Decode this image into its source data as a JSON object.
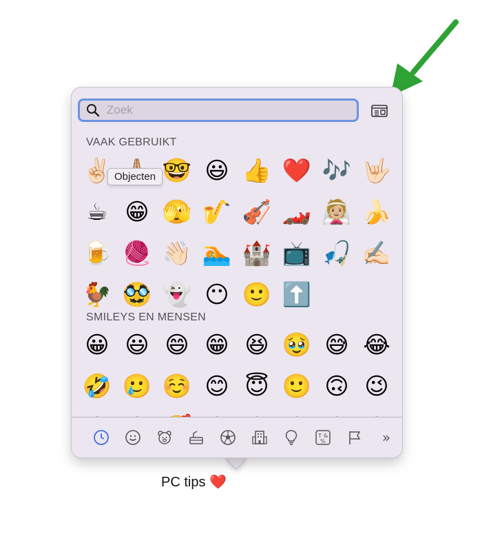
{
  "search": {
    "placeholder": "Zoek"
  },
  "tooltip": "Objecten",
  "sections": [
    {
      "title": "VAAK GEBRUIKT",
      "emojis": [
        "✌🏻",
        "🙏🏼",
        "🤓",
        "😃",
        "👍",
        "❤️",
        "🎶",
        "🤟🏻",
        "☕",
        "😁",
        "🫣",
        "🎷",
        "🎻",
        "🏎️",
        "👰🏼",
        "🍌",
        "🍺",
        "🧶",
        "👋🏻",
        "🏊",
        "🏰",
        "📺",
        "🎣",
        "✍🏻",
        "🐓",
        "🥸",
        "👻",
        "😶",
        "🙂",
        "⬆️"
      ]
    },
    {
      "title": "SMILEYS EN MENSEN",
      "emojis": [
        "😀",
        "😃",
        "😄",
        "😁",
        "😆",
        "🥹",
        "😅",
        "😂",
        "🤣",
        "🥲",
        "☺️",
        "😊",
        "😇",
        "🙂",
        "🙃",
        "😉",
        "😌",
        "😍",
        "🥰",
        "😘",
        "😗",
        "😙",
        "😚",
        "😋"
      ]
    }
  ],
  "toolbar": [
    "clock-icon",
    "smiley-icon",
    "bear-icon",
    "food-icon",
    "ball-icon",
    "buildings-icon",
    "bulb-icon",
    "symbols-icon",
    "flag-icon",
    "more-icon"
  ],
  "more_label": "»",
  "symbols_label": "T&%",
  "caption": {
    "text": "PC tips",
    "emoji": "❤️"
  },
  "colors": {
    "accent": "#6a93e2",
    "arrow": "#2fa235",
    "panel": "#ece6f0"
  }
}
